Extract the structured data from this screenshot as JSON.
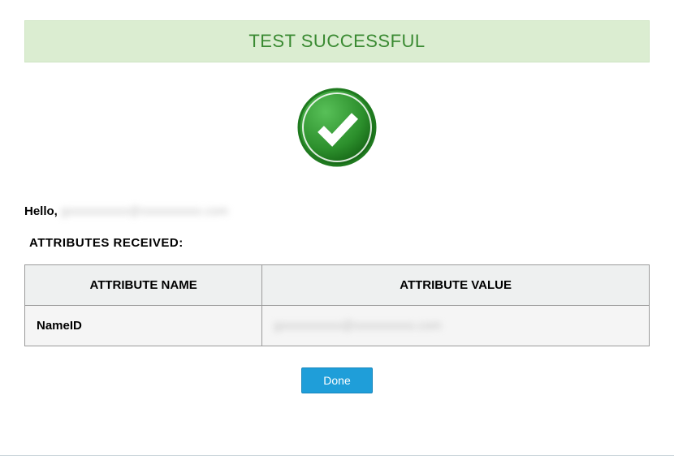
{
  "banner": {
    "title": "TEST SUCCESSFUL"
  },
  "icon": {
    "name": "check-circle-icon",
    "color": "#2c8f2c"
  },
  "greeting": {
    "prefix": "Hello,",
    "username_redacted": "gxxxxxxxxxx@xxxxxxxxxx.com"
  },
  "attributes": {
    "section_label": "ATTRIBUTES RECEIVED:",
    "columns": [
      "ATTRIBUTE NAME",
      "ATTRIBUTE VALUE"
    ],
    "rows": [
      {
        "name": "NameID",
        "value_redacted": "gxxxxxxxxxx@xxxxxxxxxx.com"
      }
    ]
  },
  "actions": {
    "done_label": "Done"
  }
}
